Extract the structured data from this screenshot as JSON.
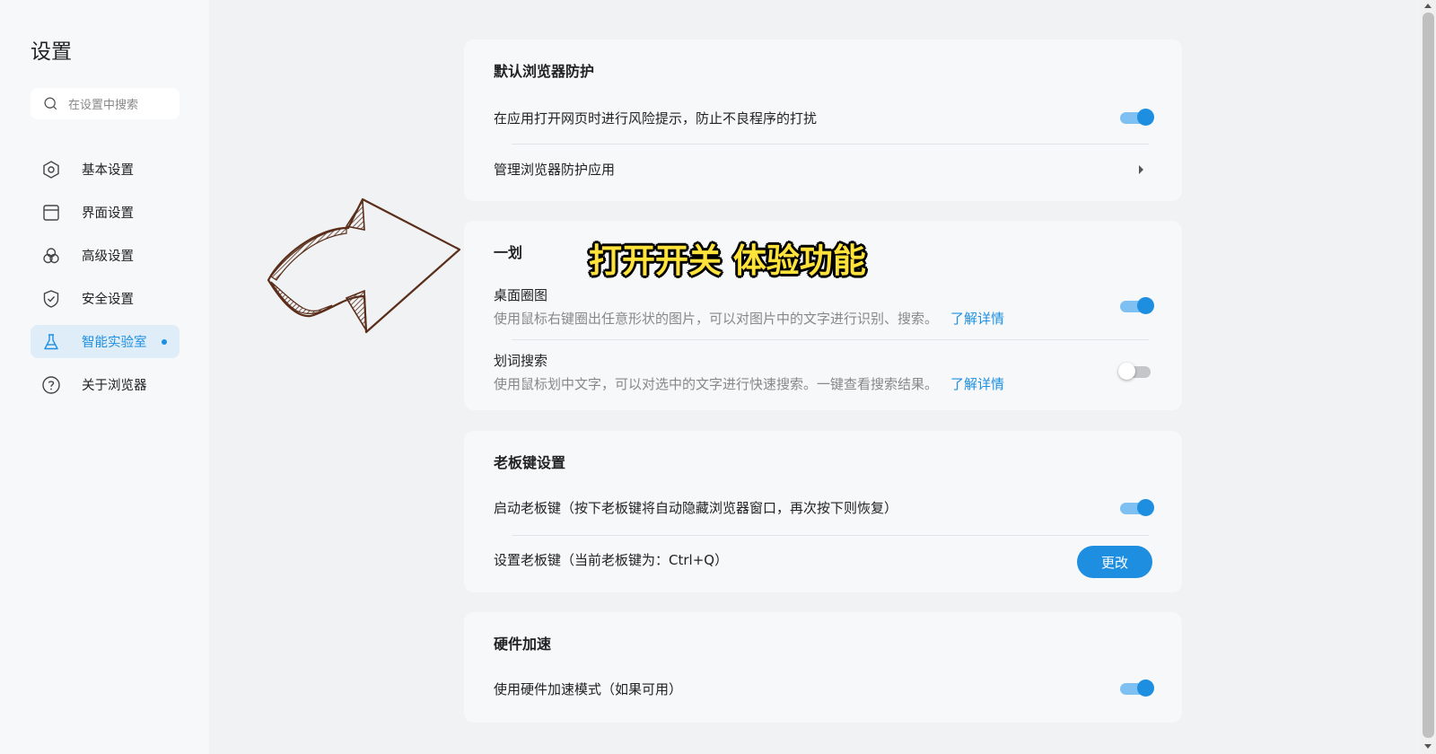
{
  "sidebar": {
    "title": "设置",
    "search_placeholder": "在设置中搜索",
    "items": [
      {
        "label": "基本设置",
        "icon": "hexagon-settings-icon"
      },
      {
        "label": "界面设置",
        "icon": "window-icon"
      },
      {
        "label": "高级设置",
        "icon": "circles-icon"
      },
      {
        "label": "安全设置",
        "icon": "shield-icon"
      },
      {
        "label": "智能实验室",
        "icon": "flask-icon",
        "active": true
      },
      {
        "label": "关于浏览器",
        "icon": "help-circle-icon"
      }
    ]
  },
  "sections": {
    "browser_protection": {
      "title": "默认浏览器防护",
      "risk_prompt": {
        "label": "在应用打开网页时进行风险提示，防止不良程序的打扰",
        "enabled": true
      },
      "manage": {
        "label": "管理浏览器防护应用"
      }
    },
    "yihua": {
      "title": "一划",
      "desktop_circle": {
        "label": "桌面圈图",
        "desc": "使用鼠标右键圈出任意形状的图片，可以对图片中的文字进行识别、搜索。",
        "link": "了解详情",
        "enabled": true
      },
      "word_search": {
        "label": "划词搜索",
        "desc": "使用鼠标划中文字，可以对选中的文字进行快速搜索。一键查看搜索结果。",
        "link": "了解详情",
        "enabled": false
      }
    },
    "boss_key": {
      "title": "老板键设置",
      "enable": {
        "label": "启动老板键（按下老板键将自动隐藏浏览器窗口，再次按下则恢复）",
        "enabled": true
      },
      "set": {
        "label": "设置老板键（当前老板键为：Ctrl+Q）",
        "button": "更改"
      }
    },
    "hardware": {
      "title": "硬件加速",
      "enable": {
        "label": "使用硬件加速模式（如果可用）",
        "enabled": true
      }
    }
  },
  "annotation": {
    "text": "打开开关 体验功能"
  },
  "colors": {
    "accent": "#1e8fe0",
    "toggle_track_on": "#7fc0f2",
    "annotation_fill": "#ffe23a",
    "arrow_stroke": "#5a2e1a"
  }
}
